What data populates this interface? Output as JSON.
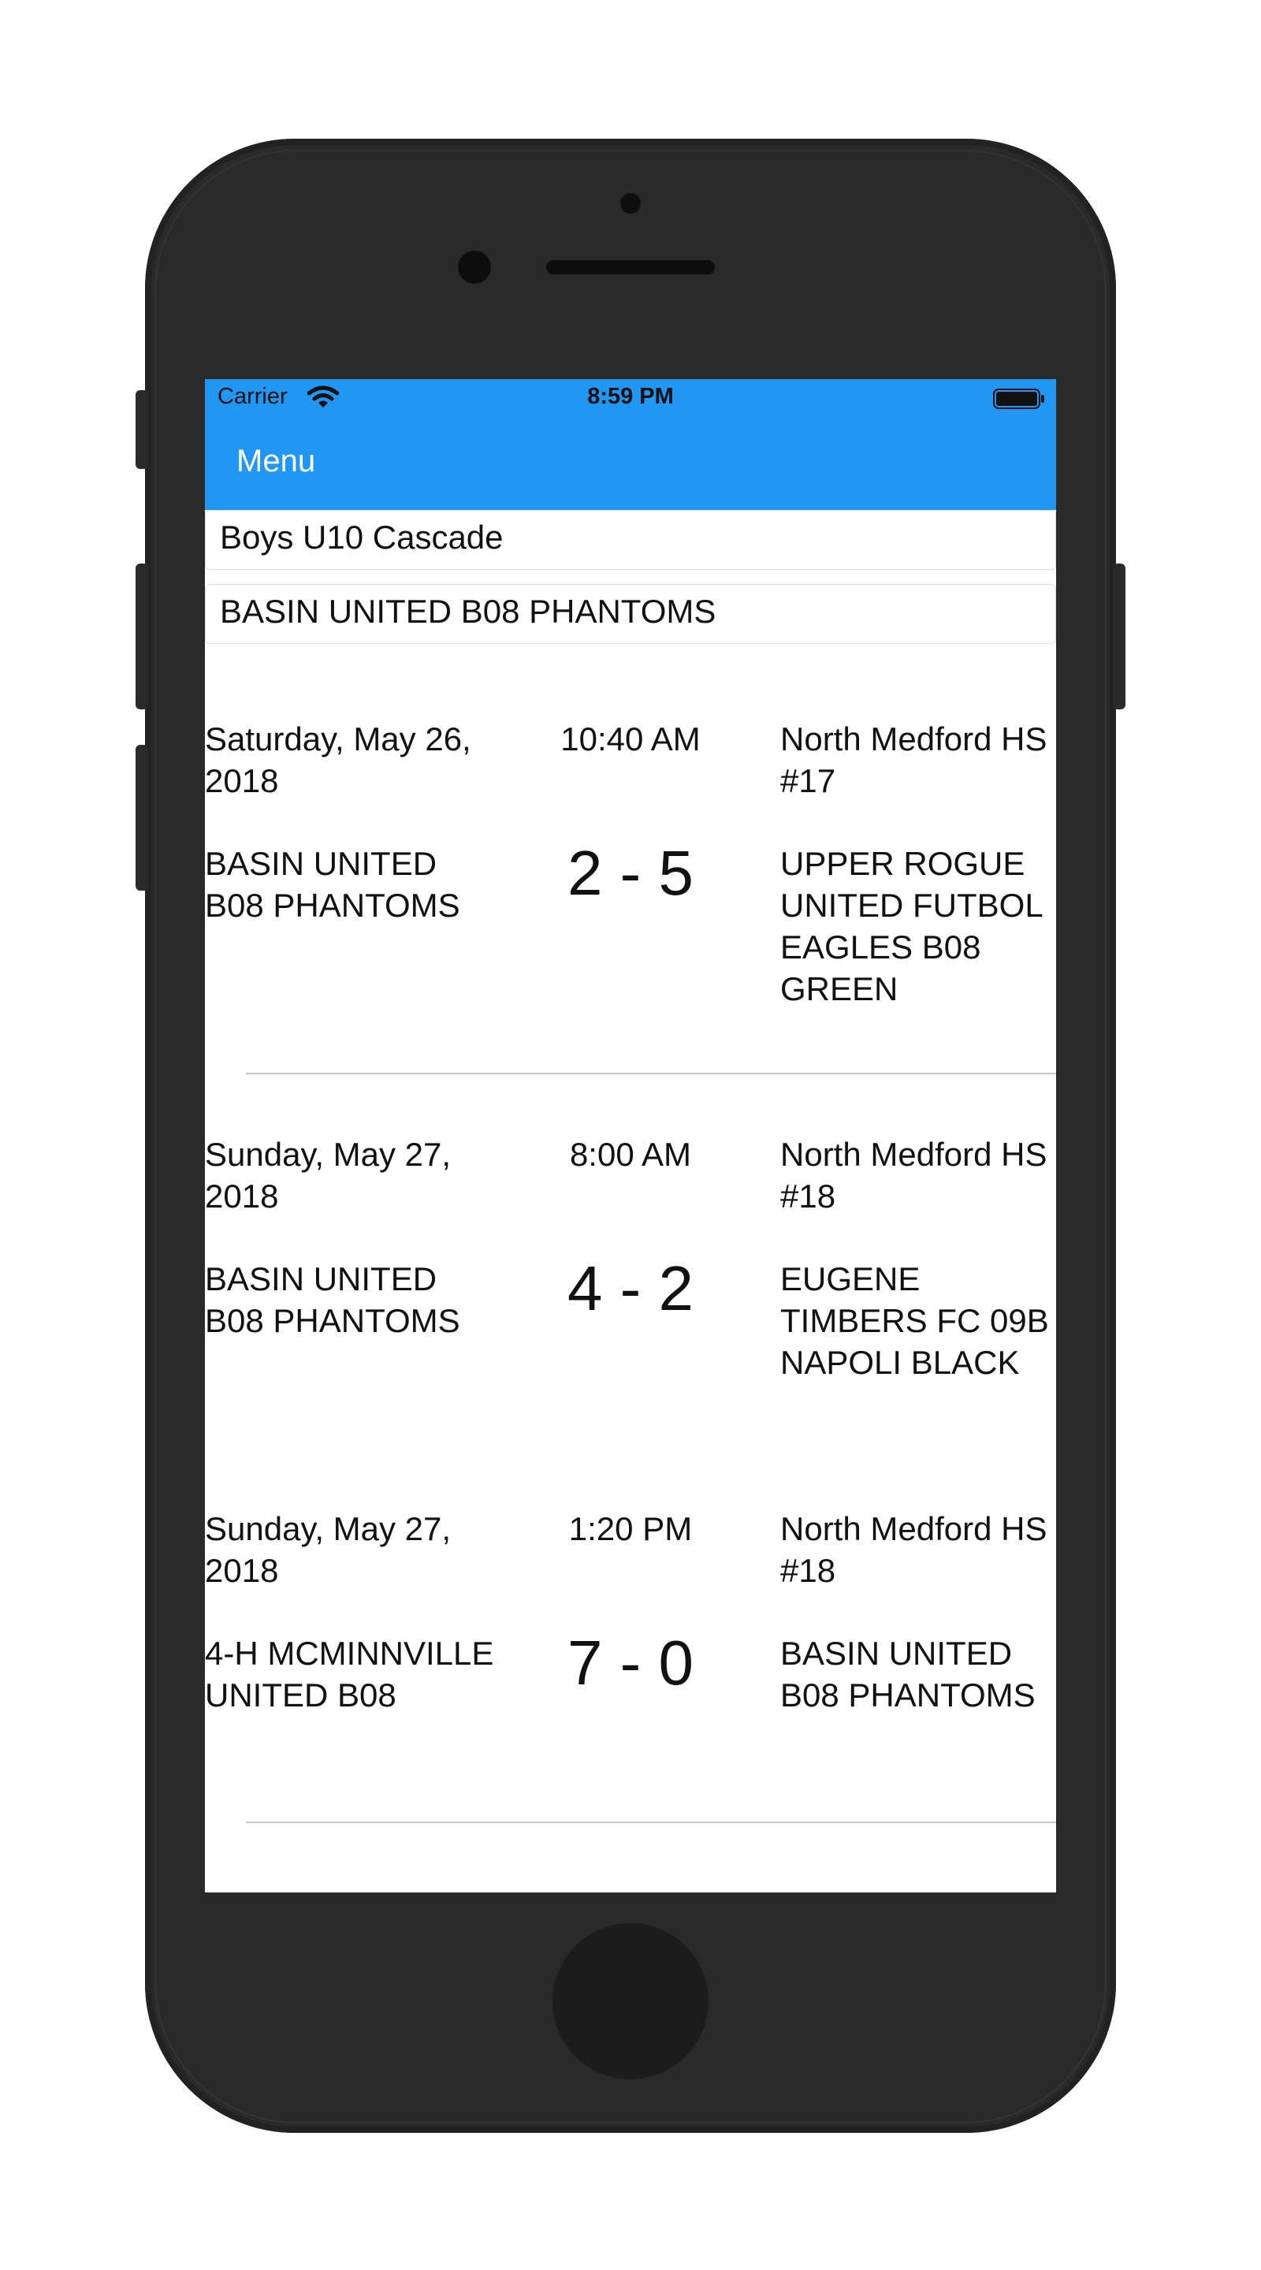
{
  "status_bar": {
    "carrier": "Carrier",
    "time": "8:59 PM",
    "wifi_icon": "wifi-icon",
    "battery_icon": "battery-icon"
  },
  "nav": {
    "menu_label": "Menu",
    "background": "#2196F3"
  },
  "filters": {
    "division": "Boys U10 Cascade",
    "team": "BASIN UNITED B08 PHANTOMS"
  },
  "games": [
    {
      "date": "Saturday, May 26, 2018",
      "time": "10:40 AM",
      "venue": "North Medford HS #17",
      "home_team": "BASIN UNITED B08 PHANTOMS",
      "score": "2 - 5",
      "away_team": "UPPER ROGUE UNITED FUTBOL EAGLES B08 GREEN"
    },
    {
      "date": "Sunday, May 27, 2018",
      "time": "8:00 AM",
      "venue": "North Medford HS #18",
      "home_team": "BASIN UNITED B08 PHANTOMS",
      "score": "4 - 2",
      "away_team": "EUGENE TIMBERS FC 09B NAPOLI BLACK"
    },
    {
      "date": "Sunday, May 27, 2018",
      "time": "1:20 PM",
      "venue": "North Medford HS #18",
      "home_team": "4-H MCMINNVILLE UNITED B08",
      "score": "7 - 0",
      "away_team": "BASIN UNITED B08 PHANTOMS"
    }
  ]
}
